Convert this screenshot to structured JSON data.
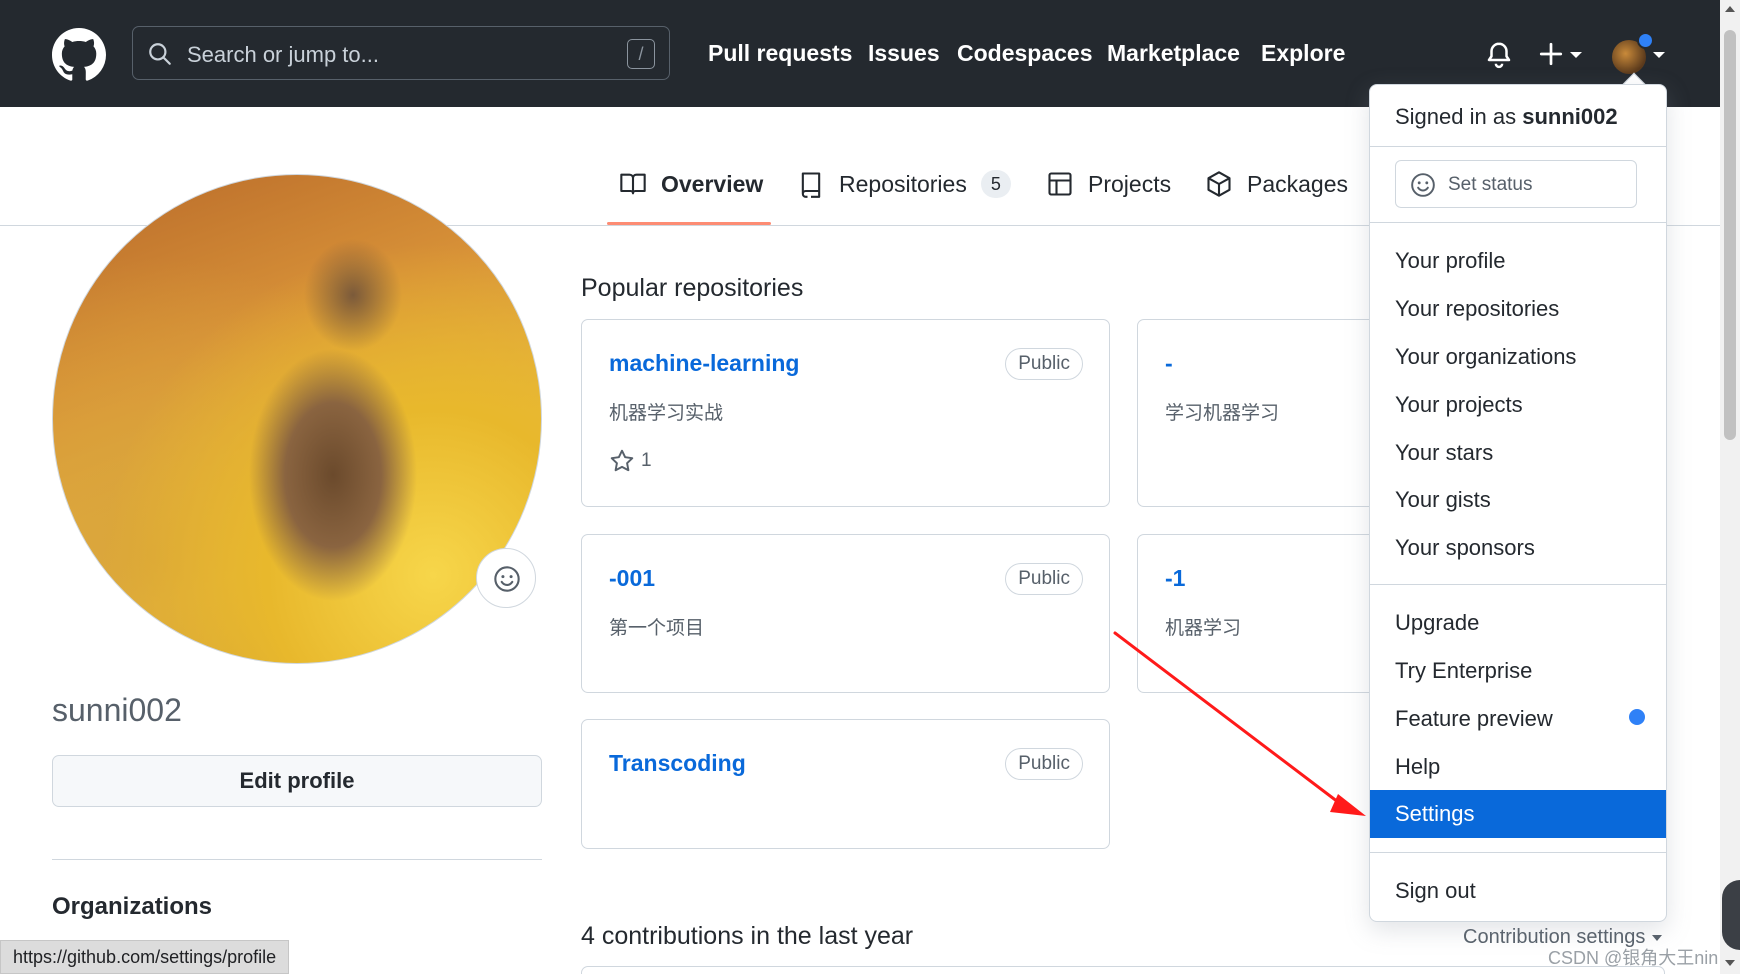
{
  "header": {
    "search_placeholder": "Search or jump to...",
    "search_shortcut": "/",
    "nav": [
      "Pull requests",
      "Issues",
      "Codespaces",
      "Marketplace",
      "Explore"
    ],
    "bg_color": "#24292f",
    "notification_dot_color": "#2f81f7"
  },
  "tabs": [
    {
      "label": "Overview",
      "icon": "book-icon",
      "active": true
    },
    {
      "label": "Repositories",
      "icon": "repo-icon",
      "count": "5"
    },
    {
      "label": "Projects",
      "icon": "project-table-icon"
    },
    {
      "label": "Packages",
      "icon": "package-icon"
    }
  ],
  "profile": {
    "username": "sunni002",
    "edit_label": "Edit profile",
    "organizations_heading": "Organizations"
  },
  "main": {
    "popular_title": "Popular repositories",
    "repos": [
      {
        "name": "machine-learning",
        "desc": "机器学习实战",
        "visibility": "Public",
        "stars": "1"
      },
      {
        "name": "-",
        "desc": "学习机器学习"
      },
      {
        "name": "-001",
        "desc": "第一个项目",
        "visibility": "Public"
      },
      {
        "name": "-1",
        "desc": "机器学习"
      },
      {
        "name": "Transcoding",
        "visibility": "Public"
      }
    ],
    "contributions_title": "4 contributions in the last year",
    "contribution_settings": "Contribution settings"
  },
  "menu": {
    "signed_in_prefix": "Signed in as",
    "signed_in_user": "sunni002",
    "set_status": "Set status",
    "group1": [
      "Your profile",
      "Your repositories",
      "Your organizations",
      "Your projects",
      "Your stars",
      "Your gists",
      "Your sponsors"
    ],
    "group2": [
      "Upgrade",
      "Try Enterprise",
      "Feature preview",
      "Help",
      "Settings"
    ],
    "sign_out": "Sign out",
    "active_color": "#0969da"
  },
  "browser": {
    "status_url": "https://github.com/settings/profile"
  },
  "watermark": "CSDN @银角大王nin",
  "annotation": {
    "arrow_color": "#ff1a1a"
  }
}
